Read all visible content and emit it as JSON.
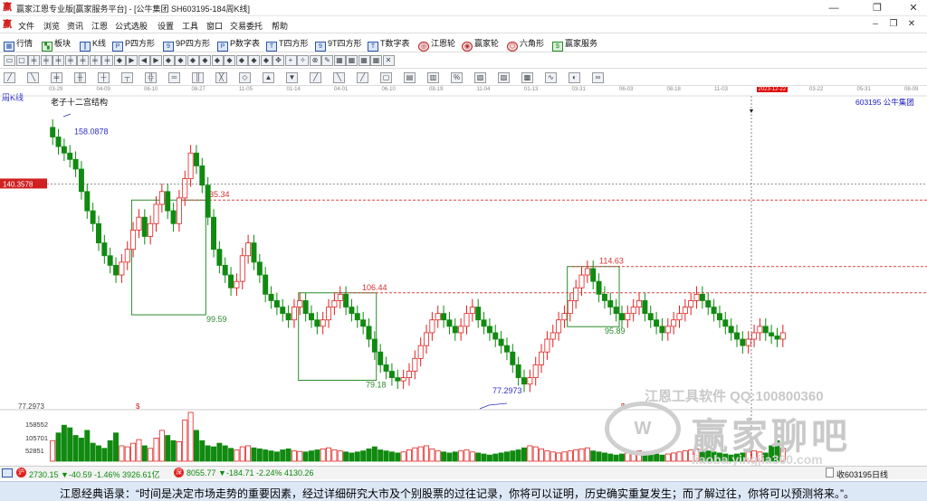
{
  "window": {
    "title": "赢家江恩专业版[赢家服务平台] - [公牛集团  SH603195-184周K线]",
    "min_icon": "minimize-icon",
    "max_icon": "restore-icon",
    "close_icon": "close-icon"
  },
  "menu": [
    "文件",
    "浏览",
    "资讯",
    "江恩",
    "公式选股",
    "设置",
    "工具",
    "窗口",
    "交易委托",
    "帮助"
  ],
  "toolbar1": [
    {
      "label": "行情",
      "icon": "grid-icon"
    },
    {
      "label": "板块",
      "icon": "blocks-icon"
    },
    {
      "label": "K线",
      "icon": "candle-icon"
    },
    {
      "label": "P四方形",
      "icon": "square-icon"
    },
    {
      "label": "9P四方形",
      "icon": "square-icon"
    },
    {
      "label": "P数字表",
      "icon": "table-icon"
    },
    {
      "label": "T四方形",
      "icon": "square-icon"
    },
    {
      "label": "9T四方形",
      "icon": "square-icon"
    },
    {
      "label": "T数字表",
      "icon": "table-icon"
    },
    {
      "label": "江恩轮",
      "icon": "wheel-icon"
    },
    {
      "label": "赢家轮",
      "icon": "wheel-icon"
    },
    {
      "label": "六角形",
      "icon": "hexagon-icon"
    },
    {
      "label": "赢家服务",
      "icon": "dollar-icon"
    }
  ],
  "chart": {
    "period_label": "周K线",
    "title": "老子十二宫结构",
    "stock_code": "603195",
    "stock_name": "公牛集团",
    "crosshair_date": "2023-12-22",
    "crosshair_price": "140.3578",
    "dates": [
      "03-29",
      "04-09",
      "06-10",
      "08-27",
      "11-05",
      "01-14",
      "04-01",
      "06-10",
      "08-19",
      "11-04",
      "01-13",
      "03-31",
      "06-03",
      "08-18",
      "11-03",
      "2023-12-22",
      "03-22",
      "05-31",
      "08-09"
    ],
    "volume_ticks": [
      "158552",
      "105701",
      "52851"
    ],
    "price_bottom_label": "77.2973",
    "watermark1": "江恩工具软件  QQ:100800360",
    "watermark2": "赢家聊吧",
    "watermark3": "liaoba.yingjia360.com",
    "dollar_marks": [
      "$",
      "$"
    ]
  },
  "chart_data": {
    "type": "candlestick",
    "levels": [
      {
        "label": "158.0878",
        "value": 158.0878
      },
      {
        "label": "135.34",
        "value": 135.34
      },
      {
        "label": "114.63",
        "value": 114.63
      },
      {
        "label": "106.44",
        "value": 106.44
      },
      {
        "label": "99.59",
        "value": 99.59
      },
      {
        "label": "95.89",
        "value": 95.89
      },
      {
        "label": "79.18",
        "value": 79.18
      },
      {
        "label": "77.2973",
        "value": 77.2973
      }
    ],
    "close_series": [
      155,
      152,
      150,
      148,
      145,
      138,
      132,
      128,
      122,
      118,
      115,
      112,
      116,
      120,
      126,
      130,
      124,
      128,
      134,
      138,
      132,
      128,
      136,
      142,
      150,
      146,
      140,
      130,
      120,
      115,
      112,
      108,
      110,
      118,
      122,
      116,
      112,
      106,
      104,
      102,
      100,
      98,
      102,
      104,
      100,
      98,
      96,
      98,
      102,
      104,
      106,
      102,
      100,
      98,
      96,
      92,
      88,
      84,
      82,
      80,
      79,
      80,
      82,
      86,
      90,
      94,
      98,
      100,
      98,
      96,
      94,
      96,
      100,
      102,
      98,
      96,
      94,
      92,
      90,
      88,
      84,
      80,
      78,
      80,
      84,
      88,
      92,
      94,
      98,
      100,
      104,
      108,
      112,
      114,
      110,
      106,
      104,
      102,
      100,
      98,
      100,
      102,
      104,
      100,
      98,
      96,
      94,
      96,
      98,
      100,
      102,
      104,
      106,
      104,
      102,
      100,
      98,
      96,
      94,
      92,
      90,
      92,
      94,
      96,
      94,
      93,
      92,
      94
    ],
    "volume_series": [
      40,
      55,
      70,
      65,
      50,
      45,
      60,
      35,
      30,
      25,
      40,
      55,
      30,
      28,
      35,
      42,
      30,
      25,
      45,
      60,
      50,
      40,
      38,
      80,
      95,
      60,
      40,
      30,
      28,
      35,
      30,
      25,
      22,
      28,
      30,
      26,
      24,
      22,
      20,
      18,
      22,
      24,
      20,
      19,
      18,
      20,
      22,
      24,
      26,
      22,
      20,
      18,
      16,
      18,
      20,
      24,
      28,
      22,
      20,
      18,
      16,
      18,
      22,
      26,
      28,
      30,
      24,
      20,
      18,
      16,
      18,
      20,
      22,
      18,
      16,
      14,
      12,
      14,
      16,
      18,
      20,
      22,
      26,
      30,
      28,
      24,
      20,
      18,
      16,
      18,
      20,
      22,
      24,
      26,
      20,
      18,
      16,
      14,
      12,
      14,
      16,
      18,
      20,
      18,
      16,
      14,
      12,
      14,
      16,
      18,
      20,
      22,
      24,
      22,
      20,
      18,
      16,
      14,
      12,
      14,
      16,
      18,
      20,
      18,
      16,
      30,
      40,
      25
    ],
    "y_range": [
      72,
      165
    ],
    "boxes": [
      {
        "name": "box-1",
        "x0": 0.142,
        "x1": 0.222,
        "y0": 135.34,
        "y1": 99.59
      },
      {
        "name": "box-2",
        "x0": 0.322,
        "x1": 0.406,
        "y0": 106.44,
        "y1": 79.18
      },
      {
        "name": "box-3",
        "x0": 0.612,
        "x1": 0.668,
        "y0": 114.63,
        "y1": 95.89
      }
    ]
  },
  "statusbar": {
    "index1": "2730.15 ▼-40.59 -1.46% 3926.61亿",
    "index2": "8055.77 ▼-184.71 -2.24% 4130.26",
    "right_text": "收603195日线"
  },
  "bottom_quote": "江恩经典语录：“时间是决定市场走势的重要因素，经过详细研究大市及个别股票的过往记录，你将可以证明，历史确实重复发生；而了解过往，你将可以预测将来。”。",
  "colors": {
    "up": "#e02020",
    "down": "#108a10",
    "accent": "#2222cc",
    "level": "#d44",
    "box": "#2a8a2a"
  }
}
